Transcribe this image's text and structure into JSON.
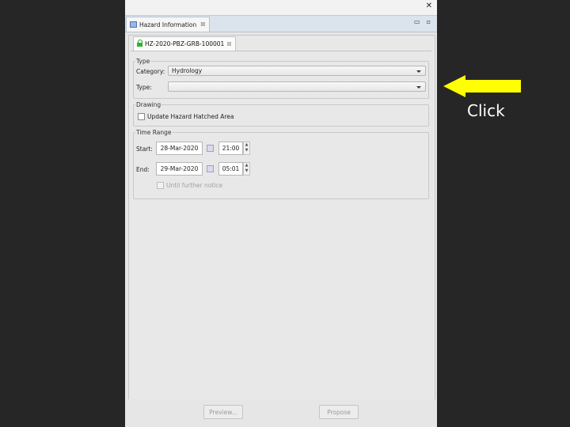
{
  "window": {
    "close_glyph": "✕"
  },
  "view_tab": {
    "label": "Hazard Information",
    "close_glyph": "☒"
  },
  "window_controls": {
    "minimize": "▭",
    "maximize": "▫"
  },
  "doc_tab": {
    "label": "HZ-2020-PBZ-GRB-100001",
    "close_glyph": "☒"
  },
  "type_group": {
    "legend": "Type",
    "category_label": "Category:",
    "category_value": "Hydrology",
    "type_label": "Type:",
    "type_value": ""
  },
  "drawing_group": {
    "legend": "Drawing",
    "update_label": "Update Hazard Hatched Area",
    "update_checked": false
  },
  "time_group": {
    "legend": "Time Range",
    "start_label": "Start:",
    "start_date": "28-Mar-2020",
    "start_time": "21:00",
    "end_label": "End:",
    "end_date": "29-Mar-2020",
    "end_time": "05:01",
    "until_label": "Until further notice",
    "until_checked": false
  },
  "buttons": {
    "preview": "Preview...",
    "propose": "Propose"
  },
  "annotation": {
    "text": "Click",
    "arrow_color": "#ffff00"
  },
  "colors": {
    "background": "#262626",
    "panel": "#e8e8e8",
    "tab_bar": "#dbe3ec"
  }
}
